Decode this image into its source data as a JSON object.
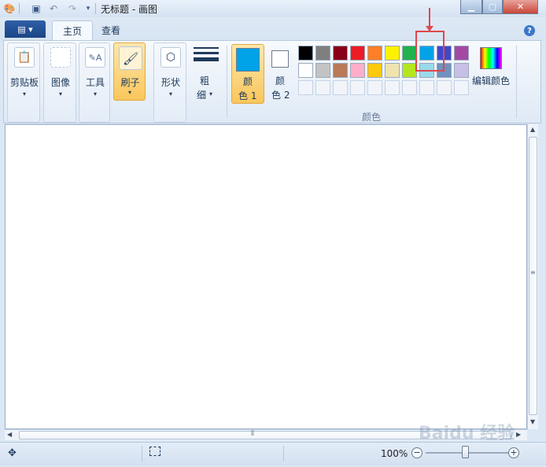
{
  "window": {
    "title": "无标题 - 画图",
    "controls": [
      "minimize",
      "maximize",
      "close"
    ]
  },
  "tabs": [
    {
      "label": "主页",
      "active": true
    },
    {
      "label": "查看",
      "active": false
    }
  ],
  "file_button": "▤ ▾",
  "help": "?",
  "ribbon": {
    "groups": [
      {
        "label": "剪贴板",
        "icon": "clipboard-icon"
      },
      {
        "label": "图像",
        "icon": "selection-icon"
      },
      {
        "label": "工具",
        "icon": "tools-icon"
      },
      {
        "label": "刷子",
        "icon": "brush-icon",
        "highlighted": true
      },
      {
        "label": "形状",
        "icon": "shapes-icon"
      }
    ],
    "size": {
      "label1": "粗",
      "label2": "细"
    },
    "color1": {
      "label1": "颜",
      "label2": "色 1",
      "value": "#00a2e8",
      "highlighted": true
    },
    "color2": {
      "label1": "颜",
      "label2": "色 2",
      "value": "#ffffff"
    },
    "colors_label": "颜色",
    "edit_colors": "编辑颜色",
    "palette_row1": [
      "#000000",
      "#7f7f7f",
      "#880015",
      "#ed1c24",
      "#ff7f27",
      "#fff200",
      "#22b14c",
      "#00a2e8",
      "#3f48cc",
      "#a349a4"
    ],
    "palette_row2": [
      "#ffffff",
      "#c3c3c3",
      "#b97a57",
      "#ffaec9",
      "#ffc90e",
      "#efe4b0",
      "#b5e61d",
      "#99d9ea",
      "#7092be",
      "#c8bfe7"
    ],
    "palette_row3_empty": 10
  },
  "status": {
    "zoom": "100%"
  },
  "watermark": "Baidu 经验"
}
